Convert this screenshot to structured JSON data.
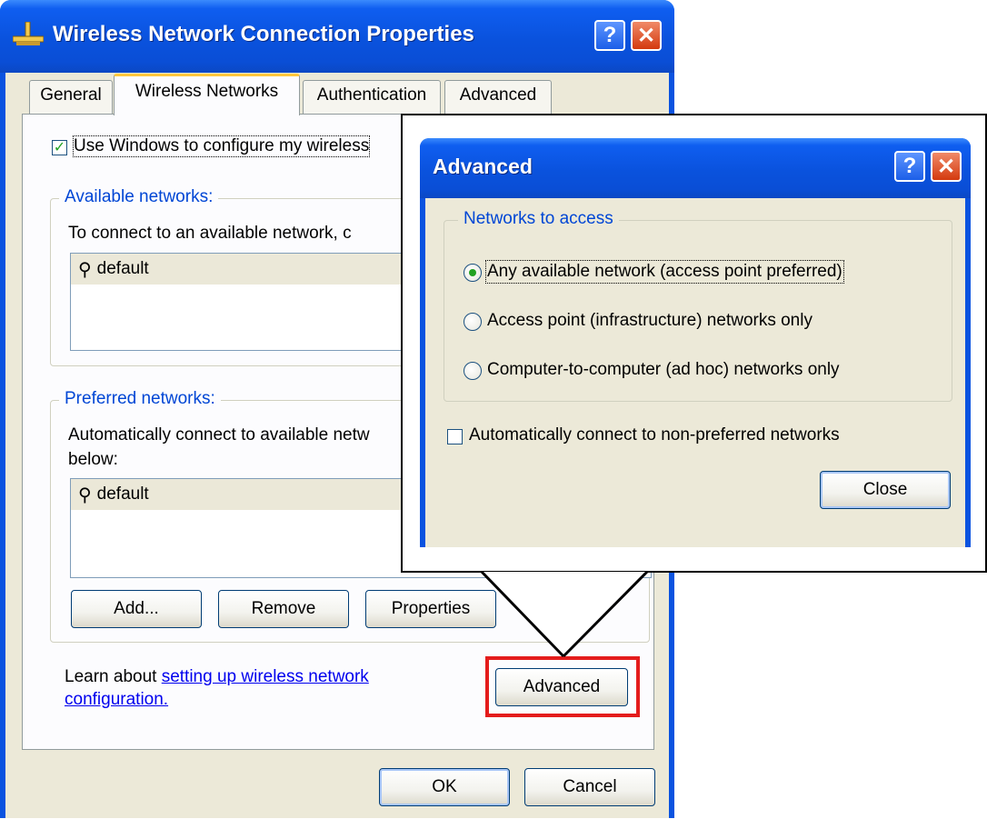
{
  "main_window": {
    "title": "Wireless Network Connection Properties",
    "tabs": [
      "General",
      "Wireless Networks",
      "Authentication",
      "Advanced"
    ],
    "use_windows_label": "Use Windows to configure my wireless",
    "available": {
      "group_label": "Available networks:",
      "description": "To connect to an available network, c",
      "networks": [
        "default"
      ]
    },
    "preferred": {
      "group_label": "Preferred networks:",
      "description_line1": "Automatically connect to available netw",
      "description_line2": "below:",
      "networks": [
        "default"
      ]
    },
    "buttons": {
      "add": "Add...",
      "remove": "Remove",
      "properties": "Properties",
      "advanced": "Advanced",
      "ok": "OK",
      "cancel": "Cancel"
    },
    "learn_prefix": "Learn about ",
    "learn_link_line1": "setting up wireless network",
    "learn_link_line2": "configuration."
  },
  "advanced_dialog": {
    "title": "Advanced",
    "group_label": "Networks to access",
    "options": [
      "Any available network (access point preferred)",
      "Access point (infrastructure) networks only",
      "Computer-to-computer (ad hoc) networks only"
    ],
    "selected_option": 0,
    "auto_connect_label": "Automatically connect to non-preferred networks",
    "auto_connect_checked": false,
    "close_button": "Close"
  },
  "colors": {
    "xp_blue": "#0a53e0",
    "dialog_face": "#ece9d8",
    "highlight_red": "#e41c1c",
    "check_green": "#21a121",
    "group_label_blue": "#0046d5"
  },
  "icons": {
    "title_icon": "network-connection-icon",
    "network_icon": "wireless-antenna-icon"
  }
}
